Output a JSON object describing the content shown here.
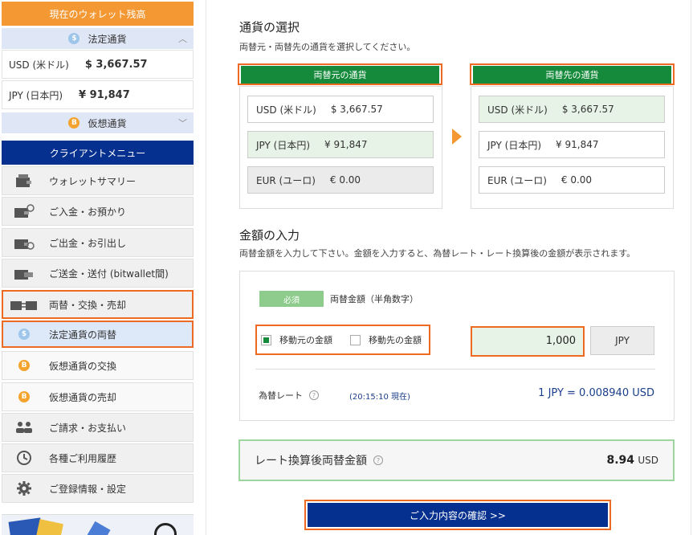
{
  "sidebar": {
    "wallet_title": "現在のウォレット残高",
    "fiat_label": "法定通貨",
    "crypto_label": "仮想通貨",
    "balances": [
      {
        "currency": "USD (米ドル)",
        "amount": "$ 3,667.57"
      },
      {
        "currency": "JPY (日本円)",
        "amount": "¥ 91,847"
      }
    ],
    "client_menu_title": "クライアントメニュー",
    "menu": [
      {
        "label": "ウォレットサマリー",
        "icon": "wallet-icon"
      },
      {
        "label": "ご入金・お預かり",
        "icon": "wallet-deposit-icon"
      },
      {
        "label": "ご出金・お引出し",
        "icon": "wallet-withdraw-icon"
      },
      {
        "label": "ご送金・送付 (bitwallet間)",
        "icon": "wallet-transfer-icon"
      },
      {
        "label": "両替・交換・売却",
        "icon": "wallet-exchange-icon"
      },
      {
        "label": "法定通貨の両替",
        "icon": "dollar-coin-icon"
      },
      {
        "label": "仮想通貨の交換",
        "icon": "bitcoin-coin-icon"
      },
      {
        "label": "仮想通貨の売却",
        "icon": "bitcoin-coin-icon"
      },
      {
        "label": "ご請求・お支払い",
        "icon": "users-icon"
      },
      {
        "label": "各種ご利用履歴",
        "icon": "history-icon"
      },
      {
        "label": "ご登録情報・設定",
        "icon": "gear-icon"
      }
    ]
  },
  "currency_select": {
    "title": "通貨の選択",
    "description": "両替元・両替先の通貨を選択してください。",
    "source_label": "両替元の通貨",
    "target_label": "両替先の通貨",
    "source_options": [
      {
        "currency": "USD (米ドル)",
        "amount": "$ 3,667.57"
      },
      {
        "currency": "JPY (日本円)",
        "amount": "¥ 91,847"
      },
      {
        "currency": "EUR (ユーロ)",
        "amount": "€ 0.00"
      }
    ],
    "target_options": [
      {
        "currency": "USD (米ドル)",
        "amount": "$ 3,667.57"
      },
      {
        "currency": "JPY (日本円)",
        "amount": "¥ 91,847"
      },
      {
        "currency": "EUR (ユーロ)",
        "amount": "€ 0.00"
      }
    ]
  },
  "amount_input": {
    "title": "金額の入力",
    "description": "両替金額を入力して下さい。金額を入力すると、為替レート・レート換算後の金額が表示されます。",
    "required_badge": "必須",
    "field_label": "両替金額（半角数字）",
    "radio_source": "移動元の金額",
    "radio_target": "移動先の金額",
    "amount_value": "1,000",
    "unit": "JPY",
    "rate_label": "為替レート",
    "rate_time": "(20:15:10 現在)",
    "rate_value": "1 JPY = 0.008940 USD"
  },
  "result": {
    "label": "レート換算後両替金額",
    "value": "8.94",
    "unit": "USD"
  },
  "confirm_button": "ご入力内容の確認 >>",
  "colors": {
    "orange": "#f39833",
    "navy": "#06308f",
    "green": "#158a3b",
    "highlight": "#ee6a23"
  }
}
